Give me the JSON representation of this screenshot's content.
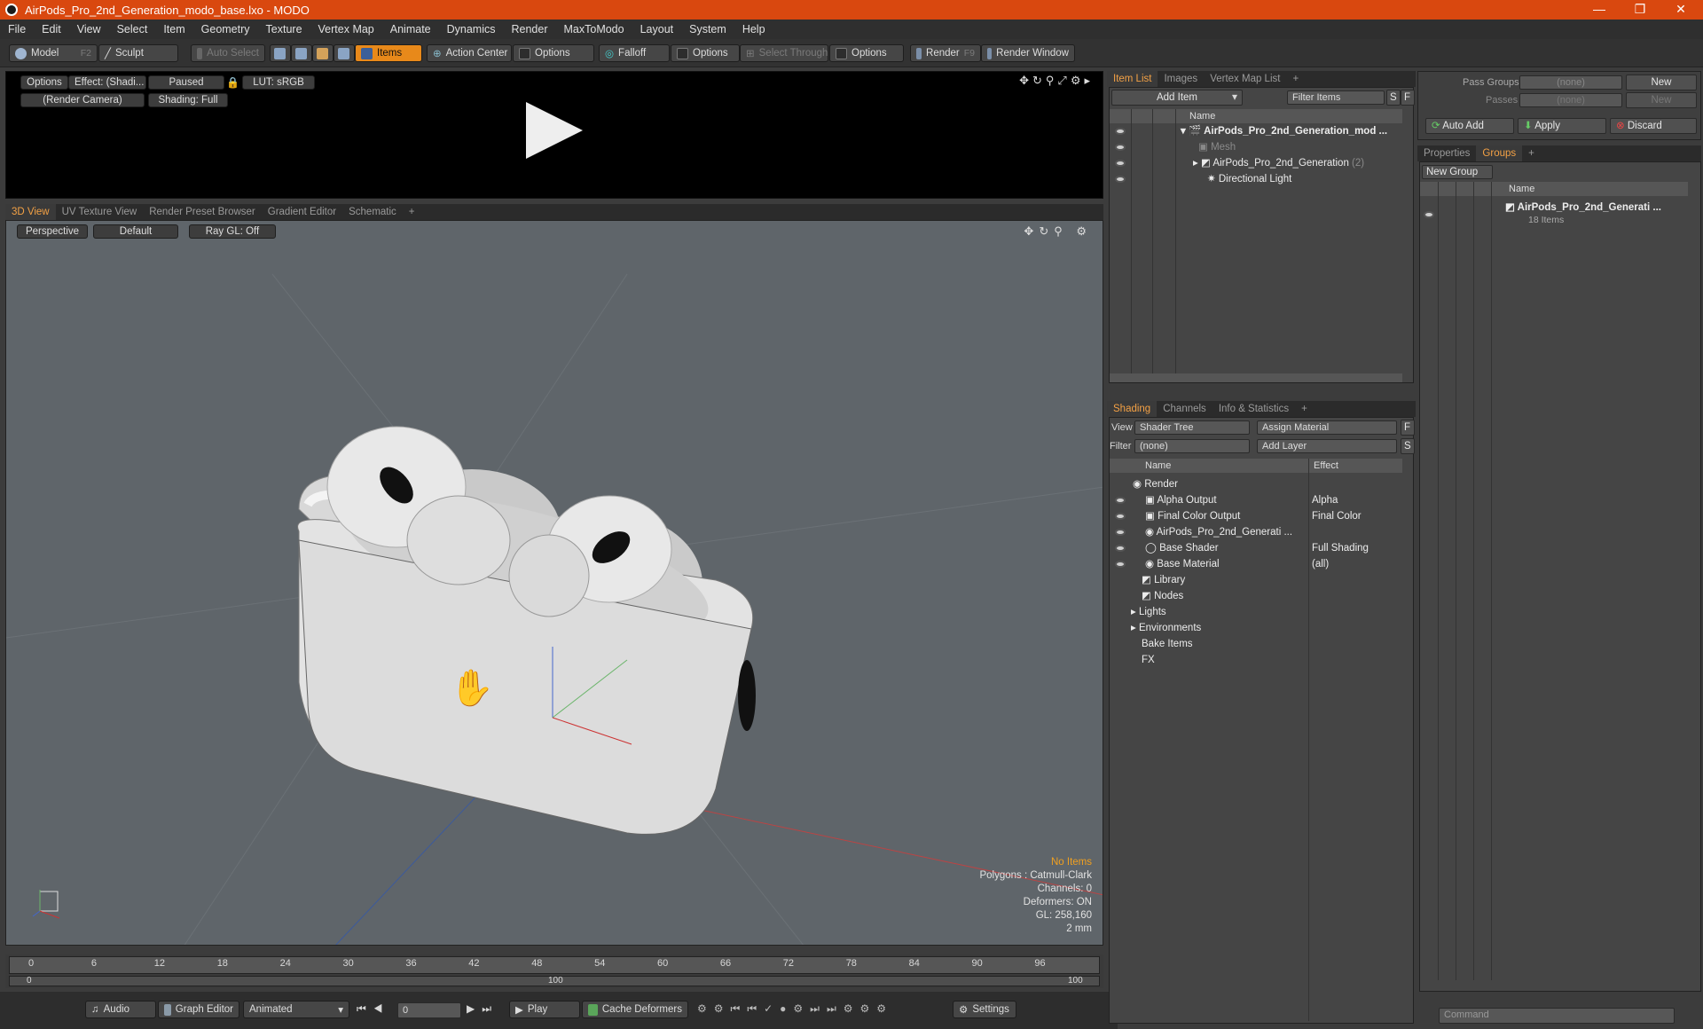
{
  "window": {
    "title": "AirPods_Pro_2nd_Generation_modo_base.lxo - MODO",
    "controls": [
      "—",
      "❐",
      "✕"
    ]
  },
  "menu": [
    "File",
    "Edit",
    "View",
    "Select",
    "Item",
    "Geometry",
    "Texture",
    "Vertex Map",
    "Animate",
    "Dynamics",
    "Render",
    "MaxToModo",
    "Layout",
    "System",
    "Help"
  ],
  "toolbar": {
    "model": "Model",
    "model_key": "F2",
    "sculpt": "Sculpt",
    "auto_select": "Auto Select",
    "items": "Items",
    "action_center": "Action Center",
    "options1": "Options",
    "falloff": "Falloff",
    "options2": "Options",
    "select_through": "Select Through",
    "options3": "Options",
    "render": "Render",
    "render_key": "F9",
    "render_window": "Render Window"
  },
  "preview": {
    "options": "Options",
    "effect": "Effect: (Shadi...",
    "paused": "Paused",
    "lut": "LUT: sRGB",
    "camera": "(Render Camera)",
    "shading": "Shading: Full"
  },
  "viewport_tabs": [
    "3D View",
    "UV Texture View",
    "Render Preset Browser",
    "Gradient Editor",
    "Schematic",
    "+"
  ],
  "viewport": {
    "perspective": "Perspective",
    "default": "Default",
    "raygl": "Ray GL: Off",
    "info": {
      "no_items": "No Items",
      "polygons": "Polygons : Catmull-Clark",
      "channels": "Channels: 0",
      "deformers": "Deformers: ON",
      "gl": "GL: 258,160",
      "scale": "2 mm"
    }
  },
  "timeline": {
    "ticks": [
      "0",
      "6",
      "12",
      "18",
      "24",
      "30",
      "36",
      "42",
      "48",
      "54",
      "60",
      "66",
      "72",
      "78",
      "84",
      "90",
      "96"
    ],
    "sub_start": "0",
    "sub_mid": "100",
    "sub_end": "100"
  },
  "bottombar": {
    "audio": "Audio",
    "graph_editor": "Graph Editor",
    "animated": "Animated",
    "frame": "0",
    "play": "Play",
    "cache": "Cache Deformers",
    "settings": "Settings"
  },
  "item_list": {
    "tabs": [
      "Item List",
      "Images",
      "Vertex Map List",
      "+"
    ],
    "add_item": "Add Item",
    "filter_items": "Filter Items",
    "s": "S",
    "f": "F",
    "col_name": "Name",
    "rows": [
      {
        "label": "AirPods_Pro_2nd_Generation_mod ...",
        "bold": true
      },
      {
        "label": "Mesh",
        "dim": true
      },
      {
        "label": "AirPods_Pro_2nd_Generation",
        "count": "(2)"
      },
      {
        "label": "Directional Light"
      }
    ]
  },
  "shading": {
    "tabs": [
      "Shading",
      "Channels",
      "Info & Statistics",
      "+"
    ],
    "view_label": "View",
    "view_value": "Shader Tree",
    "assign_material": "Assign Material",
    "f": "F",
    "filter_label": "Filter",
    "filter_value": "(none)",
    "add_layer": "Add Layer",
    "s": "S",
    "col_name": "Name",
    "col_effect": "Effect",
    "rows": [
      {
        "name": "Render",
        "effect": ""
      },
      {
        "name": "Alpha Output",
        "effect": "Alpha"
      },
      {
        "name": "Final Color Output",
        "effect": "Final Color"
      },
      {
        "name": "AirPods_Pro_2nd_Generati ...",
        "effect": ""
      },
      {
        "name": "Base Shader",
        "effect": "Full Shading"
      },
      {
        "name": "Base Material",
        "effect": "(all)"
      },
      {
        "name": "Library",
        "effect": ""
      },
      {
        "name": "Nodes",
        "effect": ""
      },
      {
        "name": "Lights",
        "effect": ""
      },
      {
        "name": "Environments",
        "effect": ""
      },
      {
        "name": "Bake Items",
        "effect": ""
      },
      {
        "name": "FX",
        "effect": ""
      }
    ]
  },
  "groups": {
    "pass_groups_label": "Pass Groups",
    "pass_groups_value": "(none)",
    "new1": "New",
    "passes_label": "Passes",
    "passes_value": "(none)",
    "new2": "New",
    "auto_add": "Auto Add",
    "apply": "Apply",
    "discard": "Discard",
    "tabs": [
      "Properties",
      "Groups",
      "+"
    ],
    "new_group": "New Group",
    "col_name": "Name",
    "group_name": "AirPods_Pro_2nd_Generati ...",
    "group_count": "18 Items"
  },
  "command": {
    "placeholder": "Command"
  },
  "colors": {
    "accent": "#e8891a",
    "title": "#d9480f",
    "active_tab": "#f3a145"
  }
}
